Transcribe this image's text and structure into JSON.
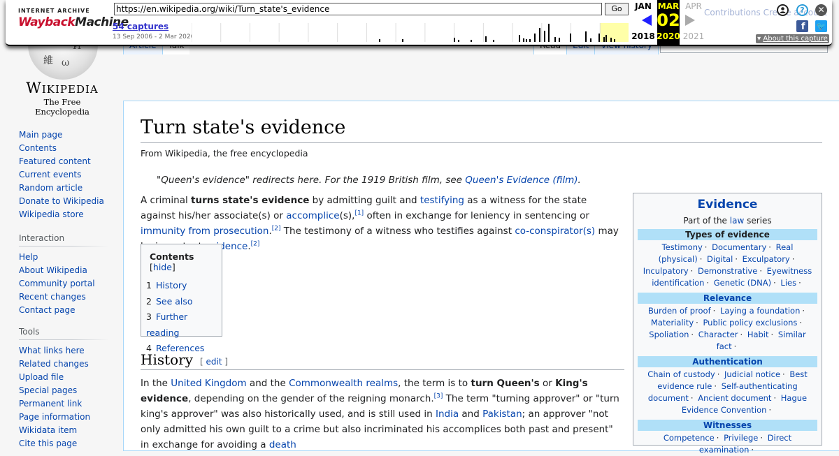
{
  "wiki": {
    "wordmark": "Wikipedia",
    "tagline": "The Free Encyclopedia",
    "user_links_partial": "Contributions   Create account",
    "tabs_left": [
      "Article",
      "Talk"
    ],
    "tabs_right": [
      "Read",
      "Edit",
      "View history"
    ],
    "nav_main": [
      "Main page",
      "Contents",
      "Featured content",
      "Current events",
      "Random article",
      "Donate to Wikipedia",
      "Wikipedia store"
    ],
    "interaction_heading": "Interaction",
    "nav_interaction": [
      "Help",
      "About Wikipedia",
      "Community portal",
      "Recent changes",
      "Contact page"
    ],
    "tools_heading": "Tools",
    "nav_tools": [
      "What links here",
      "Related changes",
      "Upload file",
      "Special pages",
      "Permanent link",
      "Page information",
      "Wikidata item",
      "Cite this page"
    ]
  },
  "article": {
    "title": "Turn state's evidence",
    "site_sub": "From Wikipedia, the free encyclopedia",
    "hatnote_prefix": "\"Queen's evidence\" redirects here. For the 1919 British film, see ",
    "hatnote_link": "Queen's Evidence (film)",
    "hatnote_suffix": ".",
    "lead": {
      "t1": "A criminal ",
      "b1": "turns state's evidence",
      "t2": " by admitting guilt and ",
      "l1": "testifying",
      "t3": " as a witness for the state against his/her associate(s) or ",
      "l2": "accomplice",
      "t4": "(s),",
      "r1": "[1]",
      "t5": " often in exchange for leniency in sentencing or ",
      "l3": "immunity from prosecution",
      "t6": ".",
      "r2": "[2]",
      "t7": " The testimony of a witness who testifies against ",
      "l4": "co-conspirator(s)",
      "t8": " may be important ",
      "l5": "evidence",
      "t9": ".",
      "r3": "[2]"
    },
    "toc": {
      "title": "Contents",
      "hide": "hide",
      "items": [
        {
          "num": "1",
          "label": "History"
        },
        {
          "num": "2",
          "label": "See also"
        },
        {
          "num": "3",
          "label": "Further reading"
        },
        {
          "num": "4",
          "label": "References"
        }
      ]
    },
    "history": {
      "heading": "History",
      "edit": "edit",
      "t1": "In the ",
      "l1": "United Kingdom",
      "t2": " and the ",
      "l2": "Commonwealth realms",
      "t3": ", the term is to ",
      "b1": "turn Queen's",
      "t4": " or ",
      "b2": "King's evidence",
      "t5": ", depending on the gender of the reigning monarch.",
      "r1": "[3]",
      "t6": " The term \"turning approver\" or \"turn king's approver\" was also historically used, and is still used in ",
      "l3": "India",
      "t7": " and ",
      "l4": "Pakistan",
      "t8": "; an approver \"not only admitted his own guilt to a crime but also incriminated his accomplices both past and present\" in exchange for avoiding a ",
      "l5": "death"
    }
  },
  "infobox": {
    "title": "Evidence",
    "sub_prefix": "Part of the ",
    "sub_link": "law",
    "sub_suffix": " series",
    "sections": [
      {
        "heading": "Types of evidence",
        "items": [
          "Testimony",
          "Documentary",
          "Real (physical)",
          "Digital",
          "Exculpatory",
          "Inculpatory",
          "Demonstrative",
          "Eyewitness identification",
          "Genetic (DNA)",
          "Lies"
        ]
      },
      {
        "heading": "Relevance",
        "items": [
          "Burden of proof",
          "Laying a foundation",
          "Materiality",
          "Public policy exclusions",
          "Spoliation",
          "Character",
          "Habit",
          "Similar fact"
        ]
      },
      {
        "heading": "Authentication",
        "items": [
          "Chain of custody",
          "Judicial notice",
          "Best evidence rule",
          "Self-authenticating document",
          "Ancient document",
          "Hague Evidence Convention"
        ]
      },
      {
        "heading": "Witnesses",
        "items": [
          "Competence",
          "Privilege",
          "Direct examination"
        ]
      }
    ]
  },
  "wayback": {
    "ia_text": "INTERNET ARCHIVE",
    "logo_a": "Wayback",
    "logo_b": "Machine",
    "url": "https://en.wikipedia.org/wiki/Turn_state's_evidence",
    "go": "Go",
    "captures": "54 captures",
    "range": "13 Sep 2006 - 2 Mar 2020",
    "prev_month": "JAN",
    "cur_month": "MAR",
    "next_month": "APR",
    "cur_day": "02",
    "prev_year": "2018",
    "cur_year": "2020",
    "next_year": "2021",
    "about": "About this capture",
    "icons": [
      "user-icon",
      "help-icon",
      "close-icon",
      "facebook-icon",
      "twitter-icon"
    ],
    "sparkline_capture_heights": [
      2,
      0,
      0,
      1,
      0,
      0,
      0,
      0,
      0,
      0,
      0,
      0,
      0,
      0,
      0,
      0,
      0,
      0,
      0,
      0,
      0,
      0,
      0,
      0,
      0,
      0,
      0,
      0,
      0,
      0,
      0,
      0,
      0,
      0,
      0,
      0,
      0,
      0,
      0,
      0,
      0,
      0,
      0,
      0,
      0,
      0,
      0,
      0,
      0,
      0,
      0,
      0,
      0,
      0,
      0,
      0,
      0,
      0,
      0,
      0,
      0,
      0,
      0,
      0,
      0,
      0,
      0,
      0,
      0,
      0,
      0,
      0,
      0,
      0,
      0,
      0,
      0,
      0,
      0,
      0,
      0,
      0,
      0,
      0,
      0,
      0,
      0,
      0,
      0,
      0,
      0,
      0,
      0,
      0,
      0,
      0,
      0,
      0,
      0,
      0,
      0,
      0,
      0,
      0,
      0,
      0,
      0,
      0,
      0,
      0,
      0,
      0,
      0,
      0,
      0,
      0,
      0,
      0,
      0,
      0,
      0,
      0,
      0,
      0,
      0,
      0,
      0,
      0,
      0,
      0,
      0,
      0,
      0,
      0,
      0,
      0,
      0,
      0,
      0,
      0,
      0,
      0,
      0,
      0,
      0,
      0,
      0,
      0,
      0,
      0,
      0,
      0,
      0,
      0,
      0,
      0,
      0,
      0,
      0,
      0,
      0,
      0,
      0,
      0,
      0,
      0,
      0,
      0,
      0,
      0,
      0,
      0
    ]
  }
}
